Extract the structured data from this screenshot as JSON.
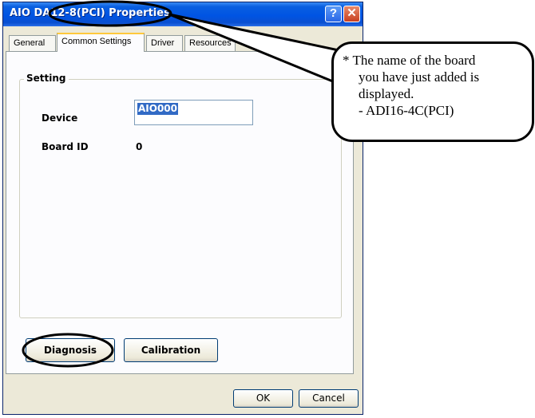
{
  "window": {
    "title": "AIO DA12-8(PCI) Properties",
    "help_glyph": "?",
    "close_glyph": "✕"
  },
  "tabs": [
    {
      "label": "General"
    },
    {
      "label": "Common Settings"
    },
    {
      "label": "Driver"
    },
    {
      "label": "Resources"
    }
  ],
  "setting": {
    "group_label": "Setting",
    "device_label": "Device",
    "device_value": "AIO000",
    "board_id_label": "Board ID",
    "board_id_value": "0"
  },
  "actions": {
    "diagnosis": "Diagnosis",
    "calibration": "Calibration",
    "ok": "OK",
    "cancel": "Cancel"
  },
  "callout": {
    "lines": [
      "* The name of the board",
      "you have just added is",
      "displayed.",
      "- ADI16-4C(PCI)"
    ]
  }
}
